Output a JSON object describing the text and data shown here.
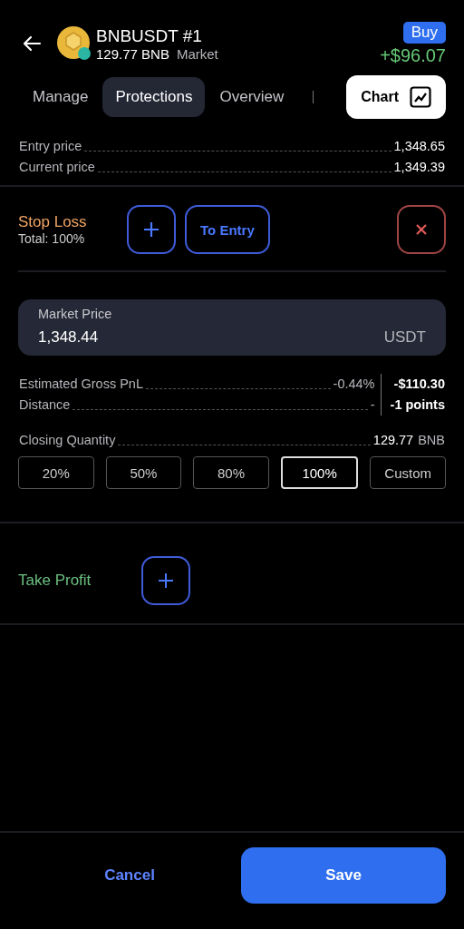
{
  "header": {
    "title": "BNBUSDT #1",
    "quantity": "129.77 BNB",
    "order_type": "Market",
    "side": "Buy",
    "pnl": "+$96.07"
  },
  "tabs": [
    {
      "label": "Manage",
      "selected": false
    },
    {
      "label": "Protections",
      "selected": true
    },
    {
      "label": "Overview",
      "selected": false
    }
  ],
  "chart_button": "Chart",
  "prices": [
    {
      "label": "Entry price",
      "value": "1,348.65"
    },
    {
      "label": "Current price",
      "value": "1,349.39"
    }
  ],
  "stop_loss": {
    "title": "Stop Loss",
    "total": "Total: 100%",
    "to_entry": "To Entry",
    "field": {
      "label": "Market Price",
      "value": "1,348.44",
      "unit": "USDT"
    },
    "pnl": {
      "label": "Estimated Gross PnL",
      "percent": "-0.44%",
      "amount": "-$110.30"
    },
    "distance": {
      "label": "Distance",
      "value": "-",
      "points": "-1 points"
    },
    "closing": {
      "label": "Closing Quantity",
      "value": "129.77",
      "unit": "BNB"
    },
    "options": [
      {
        "label": "20%",
        "selected": false
      },
      {
        "label": "50%",
        "selected": false
      },
      {
        "label": "80%",
        "selected": false
      },
      {
        "label": "100%",
        "selected": true
      },
      {
        "label": "Custom",
        "selected": false
      }
    ]
  },
  "take_profit": {
    "title": "Take Profit"
  },
  "footer": {
    "cancel": "Cancel",
    "save": "Save"
  }
}
